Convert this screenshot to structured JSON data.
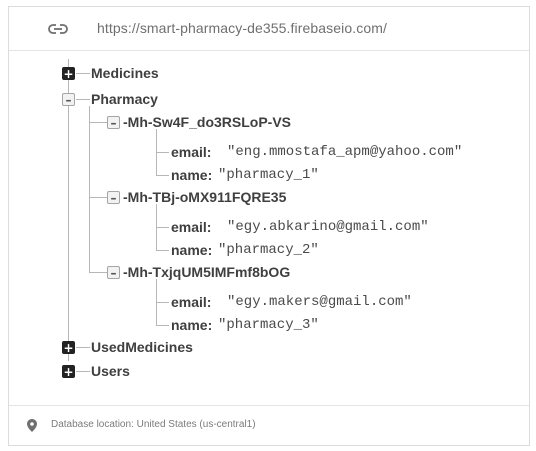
{
  "url_bar": {
    "icon": "link-icon",
    "url": "https://smart-pharmacy-de355.firebaseio.com/"
  },
  "tree": {
    "root_nodes": {
      "medicines": {
        "label": "Medicines",
        "expanded": false
      },
      "pharmacy": {
        "label": "Pharmacy",
        "expanded": true
      },
      "used_medicines": {
        "label": "UsedMedicines",
        "expanded": false
      },
      "users": {
        "label": "Users",
        "expanded": false
      }
    },
    "children": [
      {
        "key": "-Mh-Sw4F_do3RSLoP-VS",
        "email_key": "email:",
        "email_value": "\"eng.mmostafa_apm@yahoo.com\"",
        "name_key": "name:",
        "name_value": "\"pharmacy_1\""
      },
      {
        "key": "-Mh-TBj-oMX911FQRE35",
        "email_key": "email:",
        "email_value": "\"egy.abkarino@gmail.com\"",
        "name_key": "name:",
        "name_value": "\"pharmacy_2\""
      },
      {
        "key": "-Mh-TxjqUM5IMFmf8bOG",
        "email_key": "email:",
        "email_value": "\"egy.makers@gmail.com\"",
        "name_key": "name:",
        "name_value": "\"pharmacy_3\""
      }
    ]
  },
  "footer": {
    "icon": "location-pin-icon",
    "text": "Database location: United States (us-central1)"
  },
  "colors": {
    "text_dark": "#3f3f3f",
    "text_muted": "#6f6f6f",
    "tree_line": "#b7b7b7"
  }
}
